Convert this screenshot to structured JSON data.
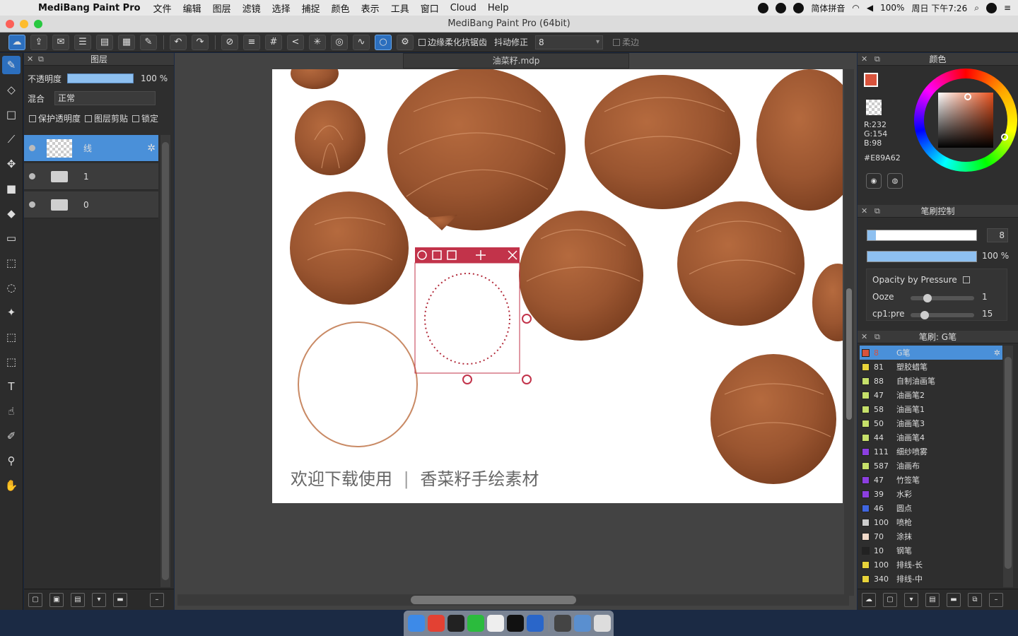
{
  "menubar": {
    "app_name": "MediBang Paint Pro",
    "items": [
      "文件",
      "编辑",
      "图层",
      "滤镜",
      "选择",
      "捕捉",
      "颜色",
      "表示",
      "工具",
      "窗口",
      "Cloud",
      "Help"
    ],
    "input_method": "简体拼音",
    "battery": "100%",
    "clock": "周日 下午7:26"
  },
  "window": {
    "title": "MediBang Paint Pro (64bit)"
  },
  "toolbar": {
    "antialias_label": "边缘柔化抗锯齿",
    "stabilizer_label": "抖动修正",
    "stabilizer_value": "8",
    "soft_label": "柔边"
  },
  "layers_panel": {
    "title": "图层",
    "opacity_label": "不透明度",
    "opacity_value": "100 %",
    "opacity_fraction": 1.0,
    "blend_label": "混合",
    "blend_value": "正常",
    "protect_alpha": "保护透明度",
    "clipping": "图层剪贴",
    "lock": "锁定",
    "layers": [
      {
        "name": "线",
        "selected": true
      },
      {
        "name": "1",
        "selected": false
      },
      {
        "name": "0",
        "selected": false
      }
    ]
  },
  "canvas": {
    "doc_tab": "油菜籽.mdp",
    "caption_left": "欢迎下载使用",
    "caption_right": "香菜籽手绘素材"
  },
  "color_panel": {
    "title": "颜色",
    "r": "R:232",
    "g": "G:154",
    "b": "B:98",
    "hex": "#E89A62",
    "main_color": "#d9533c"
  },
  "brush_control": {
    "title": "笔刷控制",
    "size_value": "8",
    "size_fraction": 0.08,
    "opacity_value": "100 %",
    "opacity_fraction": 1.0,
    "opacity_by_pressure": "Opacity by Pressure",
    "ooze_label": "Ooze",
    "ooze_value": "1",
    "cp1_label": "cp1:pre",
    "cp1_value": "15"
  },
  "brush_panel": {
    "title": "笔刷: G笔",
    "brushes": [
      {
        "size": "8",
        "name": "G笔",
        "color": "#d9533c",
        "selected": true
      },
      {
        "size": "81",
        "name": "塑胶蜡笔",
        "color": "#e8d33a"
      },
      {
        "size": "88",
        "name": "自制油画笔",
        "color": "#c6e06a"
      },
      {
        "size": "47",
        "name": "油画笔2",
        "color": "#c6e06a"
      },
      {
        "size": "58",
        "name": "油画笔1",
        "color": "#c6e06a"
      },
      {
        "size": "50",
        "name": "油画笔3",
        "color": "#c6e06a"
      },
      {
        "size": "44",
        "name": "油画笔4",
        "color": "#c6e06a"
      },
      {
        "size": "111",
        "name": "细纱喷雾",
        "color": "#8c3fe0"
      },
      {
        "size": "587",
        "name": "油画布",
        "color": "#c6e06a"
      },
      {
        "size": "47",
        "name": "竹签笔",
        "color": "#8c3fe0"
      },
      {
        "size": "39",
        "name": "水彩",
        "color": "#8c3fe0"
      },
      {
        "size": "46",
        "name": "圆点",
        "color": "#3f66e0"
      },
      {
        "size": "100",
        "name": "喷枪",
        "color": "#cccccc"
      },
      {
        "size": "70",
        "name": "涂抹",
        "color": "#f0d9c8"
      },
      {
        "size": "10",
        "name": "钢笔",
        "color": "#222222"
      },
      {
        "size": "100",
        "name": "排线-长",
        "color": "#e8d33a"
      },
      {
        "size": "340",
        "name": "排线-中",
        "color": "#e8d33a"
      }
    ]
  }
}
